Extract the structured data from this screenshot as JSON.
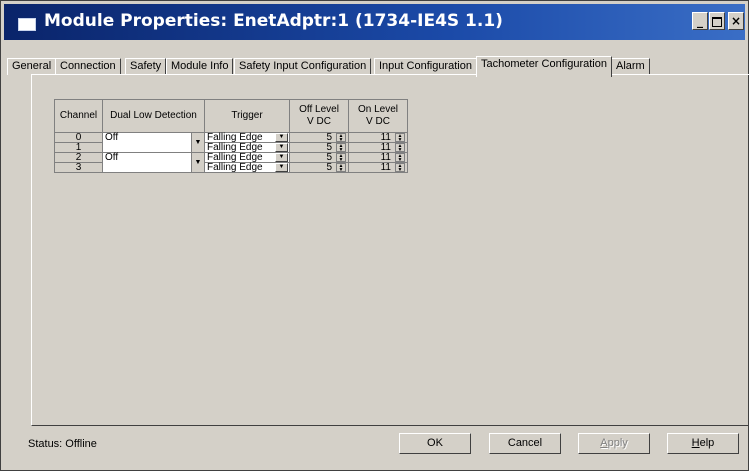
{
  "window": {
    "title": "Module Properties: EnetAdptr:1 (1734-IE4S 1.1)",
    "buttons": {
      "minimize": "_",
      "close": "×"
    }
  },
  "tabs": [
    {
      "label": "General"
    },
    {
      "label": "Connection"
    },
    {
      "label": "Safety"
    },
    {
      "label": "Module Info"
    },
    {
      "label": "Safety Input Configuration"
    },
    {
      "label": "Input Configuration"
    },
    {
      "label": "Tachometer Configuration",
      "active": true
    },
    {
      "label": "Alarm"
    }
  ],
  "grid": {
    "headers": {
      "channel": "Channel",
      "dual_low": "Dual Low Detection",
      "trigger": "Trigger",
      "off_level_1": "Off Level",
      "off_level_2": "V DC",
      "on_level_1": "On Level",
      "on_level_2": "V DC"
    },
    "rows": [
      {
        "channel": "0",
        "dual_low": "Off",
        "trigger": "Falling Edge",
        "off_level": "5",
        "on_level": "11"
      },
      {
        "channel": "1",
        "dual_low": "",
        "trigger": "Falling Edge",
        "off_level": "5",
        "on_level": "11"
      },
      {
        "channel": "2",
        "dual_low": "Off",
        "trigger": "Falling Edge",
        "off_level": "5",
        "on_level": "11"
      },
      {
        "channel": "3",
        "dual_low": "",
        "trigger": "Falling Edge",
        "off_level": "5",
        "on_level": "11"
      }
    ]
  },
  "status": {
    "text": "Status:  Offline"
  },
  "footer": {
    "ok": "OK",
    "cancel": "Cancel",
    "apply_first": "A",
    "apply_rest": "pply",
    "help_first": "H",
    "help_rest": "elp"
  }
}
